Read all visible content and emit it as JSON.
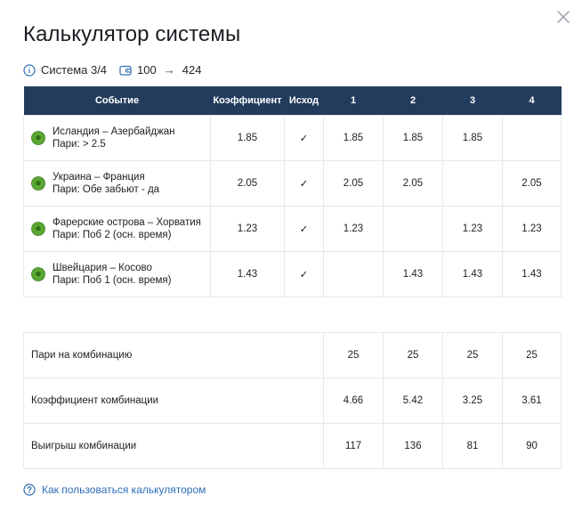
{
  "title": "Калькулятор системы",
  "info": {
    "system": "Система 3/4",
    "stake": "100",
    "arrow": "→",
    "payout": "424"
  },
  "table": {
    "headers": [
      "Событие",
      "Коэффициент",
      "Исход",
      "1",
      "2",
      "3",
      "4"
    ],
    "rows": [
      {
        "event": "Исландия – Азербайджан",
        "bet": "Пари: > 2.5",
        "coef": "1.85",
        "outcome": "✓",
        "c1": "1.85",
        "c2": "1.85",
        "c3": "1.85",
        "c4": ""
      },
      {
        "event": "Украина – Франция",
        "bet": "Пари: Обе забьют - да",
        "coef": "2.05",
        "outcome": "✓",
        "c1": "2.05",
        "c2": "2.05",
        "c3": "",
        "c4": "2.05"
      },
      {
        "event": "Фарерские острова – Хорватия",
        "bet": "Пари: Поб 2 (осн. время)",
        "coef": "1.23",
        "outcome": "✓",
        "c1": "1.23",
        "c2": "",
        "c3": "1.23",
        "c4": "1.23"
      },
      {
        "event": "Швейцария – Косово",
        "bet": "Пари: Поб 1 (осн. время)",
        "coef": "1.43",
        "outcome": "✓",
        "c1": "",
        "c2": "1.43",
        "c3": "1.43",
        "c4": "1.43"
      }
    ]
  },
  "summary": [
    {
      "label": "Пари на комбинацию",
      "c1": "25",
      "c2": "25",
      "c3": "25",
      "c4": "25"
    },
    {
      "label": "Коэффициент комбинации",
      "c1": "4.66",
      "c2": "5.42",
      "c3": "3.25",
      "c4": "3.61"
    },
    {
      "label": "Выигрыш комбинации",
      "c1": "117",
      "c2": "136",
      "c3": "81",
      "c4": "90"
    }
  ],
  "help_link": "Как пользоваться калькулятором",
  "icons": {
    "close": "close-icon",
    "info": "info-icon",
    "wallet": "wallet-icon",
    "ball": "football-icon",
    "help": "question-icon"
  },
  "colors": {
    "header_bg": "#233c5e",
    "link": "#2f6db5",
    "accent_blue": "#2f6db5",
    "ball_green": "#5aa832"
  }
}
